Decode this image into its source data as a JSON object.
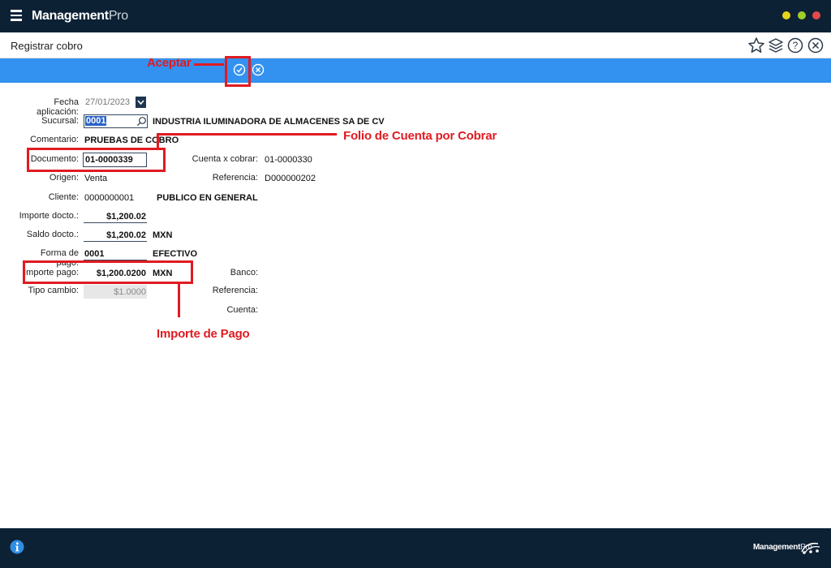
{
  "app": {
    "brand_main": "Management",
    "brand_suffix": "Pro"
  },
  "page": {
    "title": "Registrar cobro"
  },
  "form": {
    "fecha_label": "Fecha aplicación:",
    "fecha_value": "27/01/2023",
    "sucursal_label": "Sucursal:",
    "sucursal_value": "0001",
    "sucursal_name": "INDUSTRIA ILUMINADORA DE ALMACENES SA DE CV",
    "comentario_label": "Comentario:",
    "comentario_value": "PRUEBAS DE COBRO",
    "documento_label": "Documento:",
    "documento_value": "01-0000339",
    "cuenta_label": "Cuenta x cobrar:",
    "cuenta_value": "01-0000330",
    "origen_label": "Origen:",
    "origen_value": "Venta",
    "referencia_label": "Referencia:",
    "referencia_value": "D000000202",
    "cliente_label": "Cliente:",
    "cliente_value": "0000000001",
    "cliente_name": "PUBLICO EN GENERAL",
    "importe_docto_label": "Importe docto.:",
    "importe_docto_value": "$1,200.02",
    "saldo_label": "Saldo docto.:",
    "saldo_value": "$1,200.02",
    "saldo_currency": "MXN",
    "forma_label": "Forma de pago:",
    "forma_value": "0001",
    "forma_name": "EFECTIVO",
    "importe_pago_label": "Importe pago:",
    "importe_pago_value": "$1,200.0200",
    "importe_pago_currency": "MXN",
    "banco_label": "Banco:",
    "tipo_cambio_label": "Tipo cambio:",
    "tipo_cambio_value": "$1.0000",
    "referencia2_label": "Referencia:",
    "cuenta2_label": "Cuenta:"
  },
  "annotations": {
    "aceptar": "Aceptar",
    "folio": "Folio de Cuenta por Cobrar",
    "importe": "Importe de Pago"
  },
  "footer": {
    "brand_main": "Management",
    "brand_suffix": "Pro"
  },
  "colors": {
    "titlebar": "#0d2135",
    "actionbar": "#3391f0",
    "annotation": "#e01b22"
  }
}
